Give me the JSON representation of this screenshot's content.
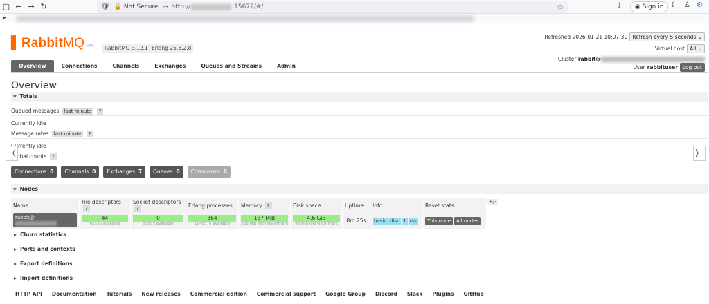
{
  "browser": {
    "not_secure": "Not Secure",
    "url_prefix": "http://",
    "url_suffix": ":15672/#/",
    "signin": "Sign in"
  },
  "header": {
    "logo_mark": "▌",
    "logo_text_bold": "Rabbit",
    "logo_text": "MQ",
    "logo_tm": "TM",
    "rabbitmq_version": "RabbitMQ 3.12.1",
    "erlang_version": "Erlang 25.3.2.8",
    "refreshed_label": "Refreshed 2026-01-21 10:07:30",
    "refresh_select": "Refresh every 5 seconds",
    "vhost_label": "Virtual host",
    "vhost_select": "All",
    "cluster_label": "Cluster",
    "cluster_name": "rabbit@",
    "user_label": "User",
    "user_name": "rabbituser",
    "logout": "Log out"
  },
  "tabs": [
    "Overview",
    "Connections",
    "Channels",
    "Exchanges",
    "Queues and Streams",
    "Admin"
  ],
  "page_title": "Overview",
  "totals": {
    "section": "Totals",
    "queued_messages": "Queued messages",
    "queued_pill": "last minute",
    "q": "?",
    "idle1": "Currently idle",
    "message_rates": "Message rates",
    "rates_pill": "last minute",
    "idle2": "Currently idle",
    "global_counts": "Global counts"
  },
  "counts": [
    {
      "label": "Connections:",
      "value": "0"
    },
    {
      "label": "Channels:",
      "value": "0"
    },
    {
      "label": "Exchanges:",
      "value": "7"
    },
    {
      "label": "Queues:",
      "value": "0"
    },
    {
      "label": "Consumers:",
      "value": "0"
    }
  ],
  "nodes": {
    "section": "Nodes",
    "headers": [
      "Name",
      "File descriptors",
      "Socket descriptors",
      "Erlang processes",
      "Memory",
      "Disk space",
      "Uptime",
      "Info",
      "Reset stats"
    ],
    "row": {
      "name": "rabbit@",
      "fd": "44",
      "fd_sub": "65536 available",
      "sd": "0",
      "sd_sub": "58893 available",
      "ep": "364",
      "ep_sub": "1048576 available",
      "mem": "137 MiB",
      "mem_sub": "366 MiB high watermark",
      "disk": "4.6 GiB",
      "disk_sub": "48 MiB low watermark",
      "uptime": "8m 25s",
      "info": [
        "basic",
        "disc",
        "1",
        "rss"
      ],
      "reset_this": "This node",
      "reset_all": "All nodes"
    },
    "plusminus": "+/-"
  },
  "sections": [
    "Churn statistics",
    "Ports and contexts",
    "Export definitions",
    "Import definitions"
  ],
  "footer": [
    "HTTP API",
    "Documentation",
    "Tutorials",
    "New releases",
    "Commercial edition",
    "Commercial support",
    "Google Group",
    "Discord",
    "Slack",
    "Plugins",
    "GitHub"
  ]
}
